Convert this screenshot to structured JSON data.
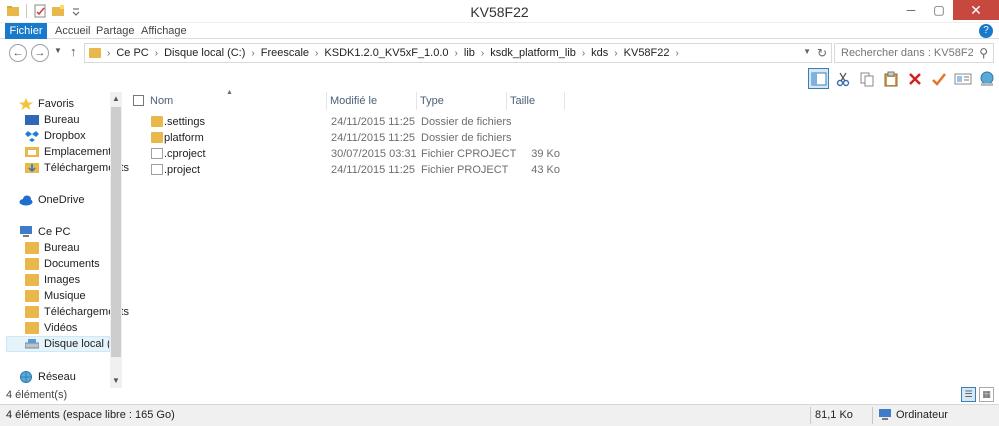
{
  "window": {
    "title": "KV58F22",
    "close_glyph": "✕",
    "maximize_glyph": "▢",
    "minimize_glyph": "─"
  },
  "ribbon": {
    "tabs": [
      "Fichier",
      "Accueil",
      "Partage",
      "Affichage"
    ],
    "help_glyph": "?"
  },
  "address": {
    "breadcrumbs": [
      "Ce PC",
      "Disque local (C:)",
      "Freescale",
      "KSDK1.2.0_KV5xF_1.0.0",
      "lib",
      "ksdk_platform_lib",
      "kds",
      "KV58F22"
    ],
    "search_placeholder": "Rechercher dans : KV58F22"
  },
  "toolbar": {
    "icons": [
      "layout-icon",
      "cut-icon",
      "copy-icon",
      "paste-icon",
      "delete-icon",
      "rename-icon",
      "properties-icon",
      "network-icon"
    ]
  },
  "navpane": {
    "items": [
      {
        "label": "Favoris",
        "icon": "star-icon"
      },
      {
        "label": "Bureau",
        "icon": "desktop-icon"
      },
      {
        "label": "Dropbox",
        "icon": "dropbox-icon"
      },
      {
        "label": "Emplacements récents",
        "icon": "recent-places-icon"
      },
      {
        "label": "Téléchargements",
        "icon": "downloads-icon"
      },
      {
        "label": "OneDrive",
        "icon": "onedrive-icon"
      },
      {
        "label": "Ce PC",
        "icon": "computer-icon"
      },
      {
        "label": "Bureau",
        "icon": "desktop-folder-icon"
      },
      {
        "label": "Documents",
        "icon": "documents-folder-icon"
      },
      {
        "label": "Images",
        "icon": "images-folder-icon"
      },
      {
        "label": "Musique",
        "icon": "music-folder-icon"
      },
      {
        "label": "Téléchargements",
        "icon": "downloads-folder-icon"
      },
      {
        "label": "Vidéos",
        "icon": "videos-folder-icon"
      },
      {
        "label": "Disque local (C:)",
        "icon": "local-disk-icon"
      },
      {
        "label": "Réseau",
        "icon": "network-icon"
      }
    ]
  },
  "columns": {
    "name": "Nom",
    "date": "Modifié le",
    "type": "Type",
    "size": "Taille"
  },
  "files": [
    {
      "name": ".settings",
      "date": "24/11/2015 11:25",
      "type": "Dossier de fichiers",
      "size": "",
      "kind": "folder"
    },
    {
      "name": "platform",
      "date": "24/11/2015 11:25",
      "type": "Dossier de fichiers",
      "size": "",
      "kind": "folder"
    },
    {
      "name": ".cproject",
      "date": "30/07/2015 03:31",
      "type": "Fichier CPROJECT",
      "size": "39 Ko",
      "kind": "file"
    },
    {
      "name": ".project",
      "date": "24/11/2015 11:25",
      "type": "Fichier PROJECT",
      "size": "43 Ko",
      "kind": "file"
    }
  ],
  "status": {
    "item_count": "4 élément(s)",
    "bottom_left": "4 éléments (espace libre : 165 Go)",
    "bottom_size": "81,1 Ko",
    "bottom_location": "Ordinateur"
  },
  "colors": {
    "accent": "#1979ca",
    "close": "#c7483e",
    "folder": "#e8b94a",
    "header_text": "#4c607a"
  }
}
